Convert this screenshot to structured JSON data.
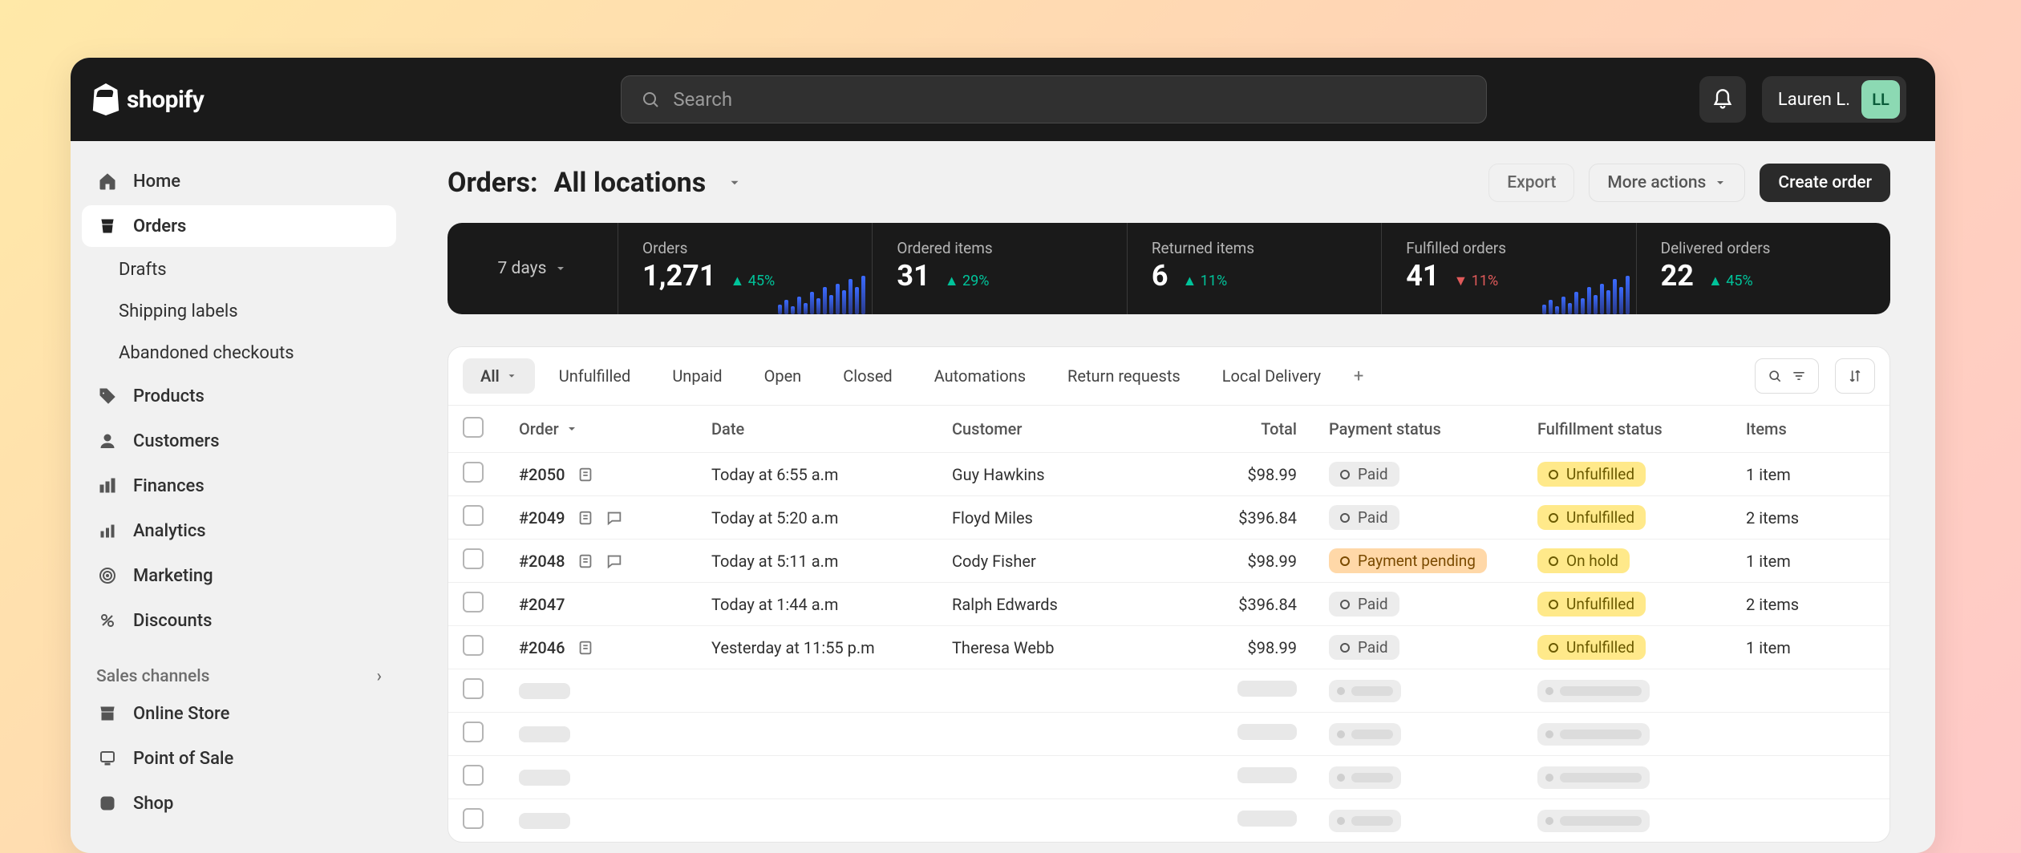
{
  "topbar": {
    "brand": "shopify",
    "search_placeholder": "Search",
    "user_name": "Lauren L.",
    "user_initials": "LL"
  },
  "sidebar": {
    "items": [
      {
        "label": "Home",
        "active": false
      },
      {
        "label": "Orders",
        "active": true
      },
      {
        "label": "Drafts",
        "sub": true
      },
      {
        "label": "Shipping labels",
        "sub": true
      },
      {
        "label": "Abandoned checkouts",
        "sub": true
      },
      {
        "label": "Products"
      },
      {
        "label": "Customers"
      },
      {
        "label": "Finances"
      },
      {
        "label": "Analytics"
      },
      {
        "label": "Marketing"
      },
      {
        "label": "Discounts"
      }
    ],
    "section_title": "Sales channels",
    "channels": [
      {
        "label": "Online Store"
      },
      {
        "label": "Point of Sale"
      },
      {
        "label": "Shop"
      }
    ]
  },
  "page": {
    "title": "Orders:",
    "location": "All locations",
    "actions": {
      "export": "Export",
      "more": "More actions",
      "create": "Create order"
    }
  },
  "stats": {
    "range": "7 days",
    "cards": [
      {
        "label": "Orders",
        "value": "1,271",
        "delta": "45%",
        "dir": "up",
        "spark": true
      },
      {
        "label": "Ordered items",
        "value": "31",
        "delta": "29%",
        "dir": "up"
      },
      {
        "label": "Returned items",
        "value": "6",
        "delta": "11%",
        "dir": "up"
      },
      {
        "label": "Fulfilled orders",
        "value": "41",
        "delta": "11%",
        "dir": "down",
        "spark": true
      },
      {
        "label": "Delivered orders",
        "value": "22",
        "delta": "45%",
        "dir": "up"
      }
    ]
  },
  "tabs": [
    "All",
    "Unfulfilled",
    "Unpaid",
    "Open",
    "Closed",
    "Automations",
    "Return requests",
    "Local Delivery"
  ],
  "columns": [
    "Order",
    "Date",
    "Customer",
    "Total",
    "Payment status",
    "Fulfillment status",
    "Items"
  ],
  "orders": [
    {
      "id": "#2050",
      "note": true,
      "chat": false,
      "date": "Today at 6:55 a.m",
      "customer": "Guy Hawkins",
      "total": "$98.99",
      "payment": "Paid",
      "pay_style": "grey",
      "fulfill": "Unfulfilled",
      "ful_style": "yellow",
      "items": "1 item"
    },
    {
      "id": "#2049",
      "note": true,
      "chat": true,
      "date": "Today at 5:20 a.m",
      "customer": "Floyd Miles",
      "total": "$396.84",
      "payment": "Paid",
      "pay_style": "grey",
      "fulfill": "Unfulfilled",
      "ful_style": "yellow",
      "items": "2 items"
    },
    {
      "id": "#2048",
      "note": true,
      "chat": true,
      "date": "Today at 5:11 a.m",
      "customer": "Cody Fisher",
      "total": "$98.99",
      "payment": "Payment pending",
      "pay_style": "orange",
      "fulfill": "On hold",
      "ful_style": "yellow",
      "items": "1 item"
    },
    {
      "id": "#2047",
      "note": false,
      "chat": false,
      "date": "Today at 1:44 a.m",
      "customer": "Ralph Edwards",
      "total": "$396.84",
      "payment": "Paid",
      "pay_style": "grey",
      "fulfill": "Unfulfilled",
      "ful_style": "yellow",
      "items": "2 items"
    },
    {
      "id": "#2046",
      "note": true,
      "chat": false,
      "date": "Yesterday at 11:55 p.m",
      "customer": "Theresa Webb",
      "total": "$98.99",
      "payment": "Paid",
      "pay_style": "grey",
      "fulfill": "Unfulfilled",
      "ful_style": "yellow",
      "items": "1 item"
    }
  ],
  "skeleton_rows": [
    {
      "d": 64,
      "c": 150
    },
    {
      "d": 180,
      "c": 190
    },
    {
      "d": 150,
      "c": 155
    },
    {
      "d": 180,
      "c": 150
    }
  ]
}
